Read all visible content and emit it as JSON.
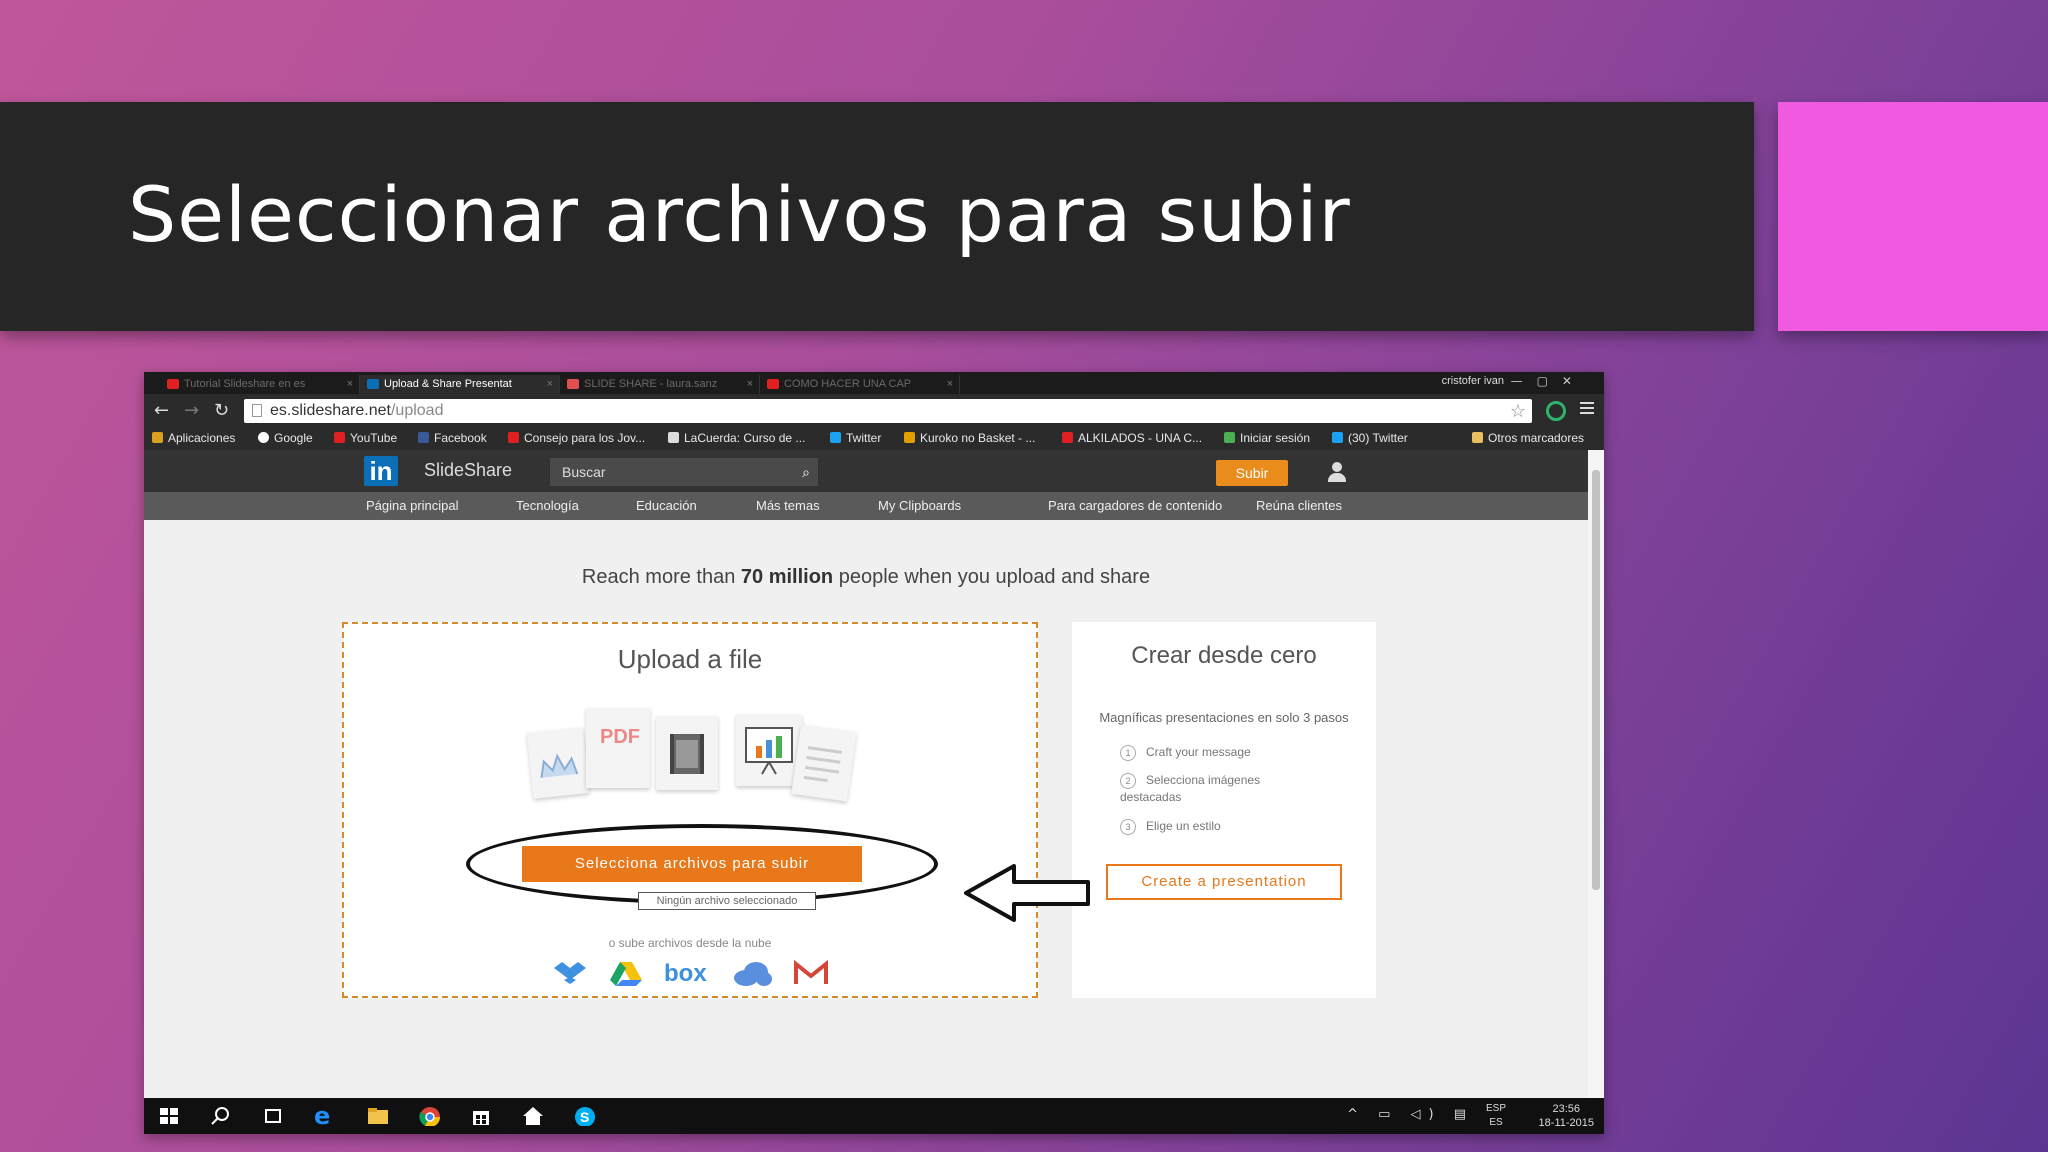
{
  "slide": {
    "title": "Seleccionar archivos para subir"
  },
  "browser": {
    "tabs": [
      {
        "label": "Tutorial Slideshare en es",
        "favicon_color": "#e02020"
      },
      {
        "label": "Upload & Share Presentat",
        "favicon_color": "#0a6fb7"
      },
      {
        "label": "SLIDE SHARE - laura.sanz",
        "favicon_color": "#e05050"
      },
      {
        "label": "COMO HACER UNA CAP",
        "favicon_color": "#e02020"
      }
    ],
    "user_name": "cristofer ivan",
    "url_domain": "es.slideshare.net",
    "url_path": "/upload",
    "bookmarks": [
      {
        "label": "Aplicaciones",
        "color": "#d9a020"
      },
      {
        "label": "Google",
        "color": "#ffffff"
      },
      {
        "label": "YouTube",
        "color": "#e02020"
      },
      {
        "label": "Facebook",
        "color": "#3b5998"
      },
      {
        "label": "Consejo para los Jov...",
        "color": "#e02020"
      },
      {
        "label": "LaCuerda: Curso de ...",
        "color": "#dddddd"
      },
      {
        "label": "Twitter",
        "color": "#1da1f2"
      },
      {
        "label": "Kuroko no Basket - ...",
        "color": "#e0a000"
      },
      {
        "label": "ALKILADOS - UNA C...",
        "color": "#e02020"
      },
      {
        "label": "Iniciar sesión",
        "color": "#4caf50"
      },
      {
        "label": "(30) Twitter",
        "color": "#1da1f2"
      },
      {
        "label": "Otros marcadores",
        "color": "#e8c060"
      }
    ]
  },
  "slideshare": {
    "logo_in": "in",
    "logo_text": "SlideShare",
    "search_placeholder": "Buscar",
    "upload_label": "Subir",
    "nav": [
      "Página principal",
      "Tecnología",
      "Educación",
      "Más temas",
      "My Clipboards",
      "Para cargadores de contenido",
      "Reúna clientes"
    ],
    "reach_prefix": "Reach more than ",
    "reach_bold": "70 million",
    "reach_suffix": " people when you upload and share",
    "upload_title": "Upload a file",
    "pdf_label": "PDF",
    "select_button": "Selecciona archivos para subir",
    "no_file_text": "Ningún archivo seleccionado",
    "cloud_text": "o sube archivos desde la nube",
    "cloud_services": [
      "box"
    ],
    "create_title": "Crear desde cero",
    "create_subtitle": "Magníficas presentaciones en solo 3 pasos",
    "steps": [
      {
        "num": "1",
        "text": "Craft your message"
      },
      {
        "num": "2",
        "text": "Selecciona imágenes destacadas"
      },
      {
        "num": "3",
        "text": "Elige un estilo"
      }
    ],
    "create_button": "Create a presentation"
  },
  "taskbar": {
    "lang_top": "ESP",
    "lang_bottom": "ES",
    "time": "23:56",
    "date": "18-11-2015"
  },
  "colors": {
    "accent_orange": "#e8781a",
    "linkedin_blue": "#0a6fb7",
    "title_band": "#262626",
    "pink_accent": "#f05ae0"
  }
}
